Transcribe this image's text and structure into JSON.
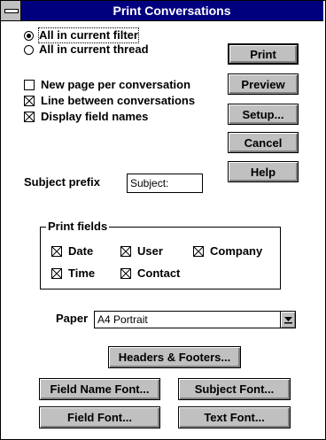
{
  "window": {
    "title": "Print Conversations"
  },
  "scope": {
    "all_in_filter": {
      "label": "All in current filter",
      "selected": true
    },
    "all_in_thread": {
      "label": "All in current thread",
      "selected": false
    }
  },
  "options": {
    "new_page": {
      "label": "New page per conversation",
      "checked": false
    },
    "line_between": {
      "label": "Line between conversations",
      "checked": true
    },
    "display_field_names": {
      "label": "Display field names",
      "checked": true
    }
  },
  "subject_prefix": {
    "label": "Subject prefix",
    "value": "Subject:"
  },
  "print_fields": {
    "legend": "Print fields",
    "date": {
      "label": "Date",
      "checked": true
    },
    "user": {
      "label": "User",
      "checked": true
    },
    "company": {
      "label": "Company",
      "checked": true
    },
    "time": {
      "label": "Time",
      "checked": true
    },
    "contact": {
      "label": "Contact",
      "checked": true
    }
  },
  "paper": {
    "label": "Paper",
    "value": "A4 Portrait"
  },
  "buttons": {
    "print": "Print",
    "preview": "Preview",
    "setup": "Setup...",
    "cancel": "Cancel",
    "help": "Help",
    "headers_footers": "Headers & Footers...",
    "field_name_font": "Field Name Font...",
    "subject_font": "Subject Font...",
    "field_font": "Field Font...",
    "text_font": "Text Font..."
  },
  "icons": {
    "system_menu": "system-menu-icon",
    "dropdown": "dropdown-arrow-icon",
    "checkmark": "x-check-icon",
    "radio": "radio-dot-icon"
  },
  "colors": {
    "titlebar": "#00007f",
    "button_face": "#c0c0c0",
    "window": "#ffffff"
  }
}
